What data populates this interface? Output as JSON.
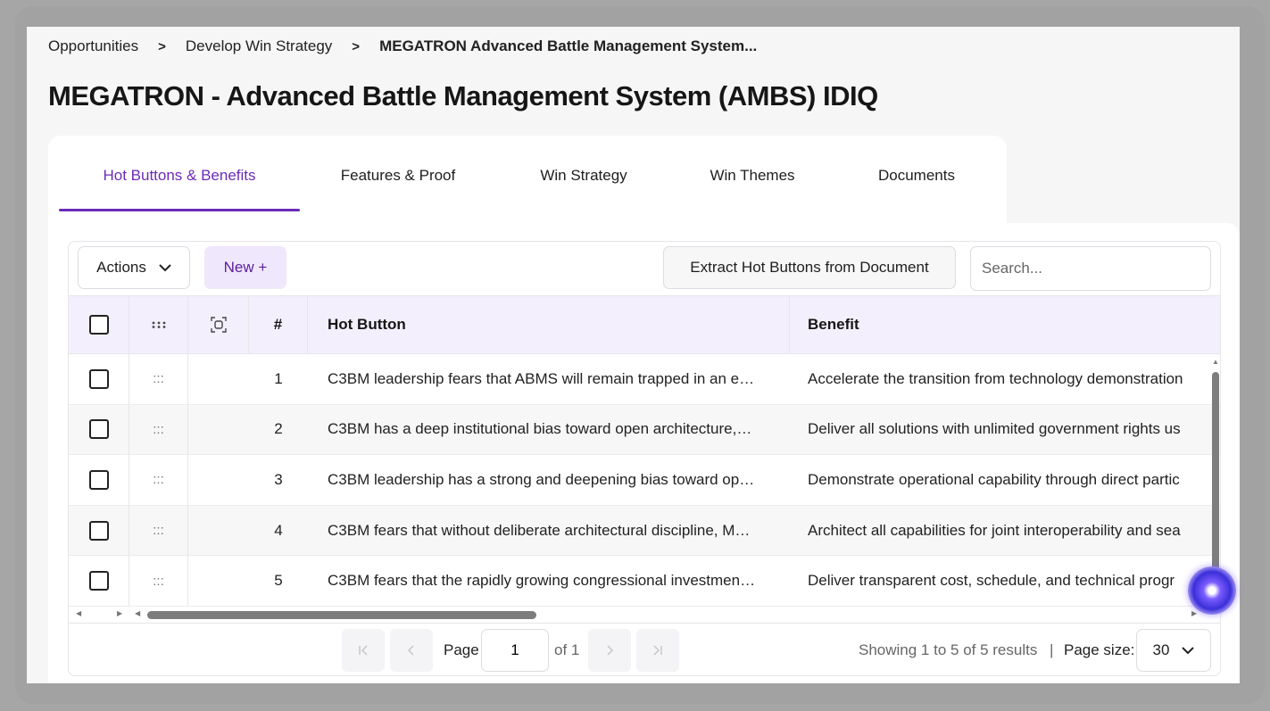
{
  "breadcrumb": [
    "Opportunities",
    "Develop Win Strategy",
    "MEGATRON Advanced Battle Management System..."
  ],
  "breadcrumb_separator": ">",
  "page_title": "MEGATRON - Advanced Battle Management System (AMBS) IDIQ",
  "tabs": [
    {
      "label": "Hot Buttons & Benefits",
      "active": true
    },
    {
      "label": "Features & Proof",
      "active": false
    },
    {
      "label": "Win Strategy",
      "active": false
    },
    {
      "label": "Win Themes",
      "active": false
    },
    {
      "label": "Documents",
      "active": false
    }
  ],
  "toolbar": {
    "actions_label": "Actions",
    "new_label": "New +",
    "extract_label": "Extract Hot Buttons from Document",
    "search_placeholder": "Search...",
    "search_value": ""
  },
  "table": {
    "columns": {
      "number": "#",
      "hot_button": "Hot Button",
      "benefit": "Benefit"
    },
    "rows": [
      {
        "num": "1",
        "hot": "C3BM leadership fears that ABMS will remain trapped in an e…",
        "benefit": "Accelerate the transition from technology demonstration"
      },
      {
        "num": "2",
        "hot": "C3BM has a deep institutional bias toward open architecture,…",
        "benefit": "Deliver all solutions with unlimited government rights us"
      },
      {
        "num": "3",
        "hot": "C3BM leadership has a strong and deepening bias toward op…",
        "benefit": "Demonstrate operational capability through direct partic"
      },
      {
        "num": "4",
        "hot": "C3BM fears that without deliberate architectural discipline, M…",
        "benefit": "Architect all capabilities for joint interoperability and sea"
      },
      {
        "num": "5",
        "hot": "C3BM fears that the rapidly growing congressional investmen…",
        "benefit": "Deliver transparent cost, schedule, and technical progr"
      }
    ]
  },
  "pagination": {
    "page_label": "Page",
    "page_value": "1",
    "of_label": "of 1",
    "showing": "Showing 1 to 5 of 5 results",
    "divider": "|",
    "page_size_label": "Page size:",
    "page_size_value": "30"
  },
  "colors": {
    "accent": "#6b2bb8",
    "header_bg": "#f3effd",
    "new_button_bg": "#efe7fb"
  },
  "icons": {
    "drag_handle": "drag-dots-icon",
    "column_icon": "select-frame-icon",
    "chevron": "chevron-down-icon"
  }
}
